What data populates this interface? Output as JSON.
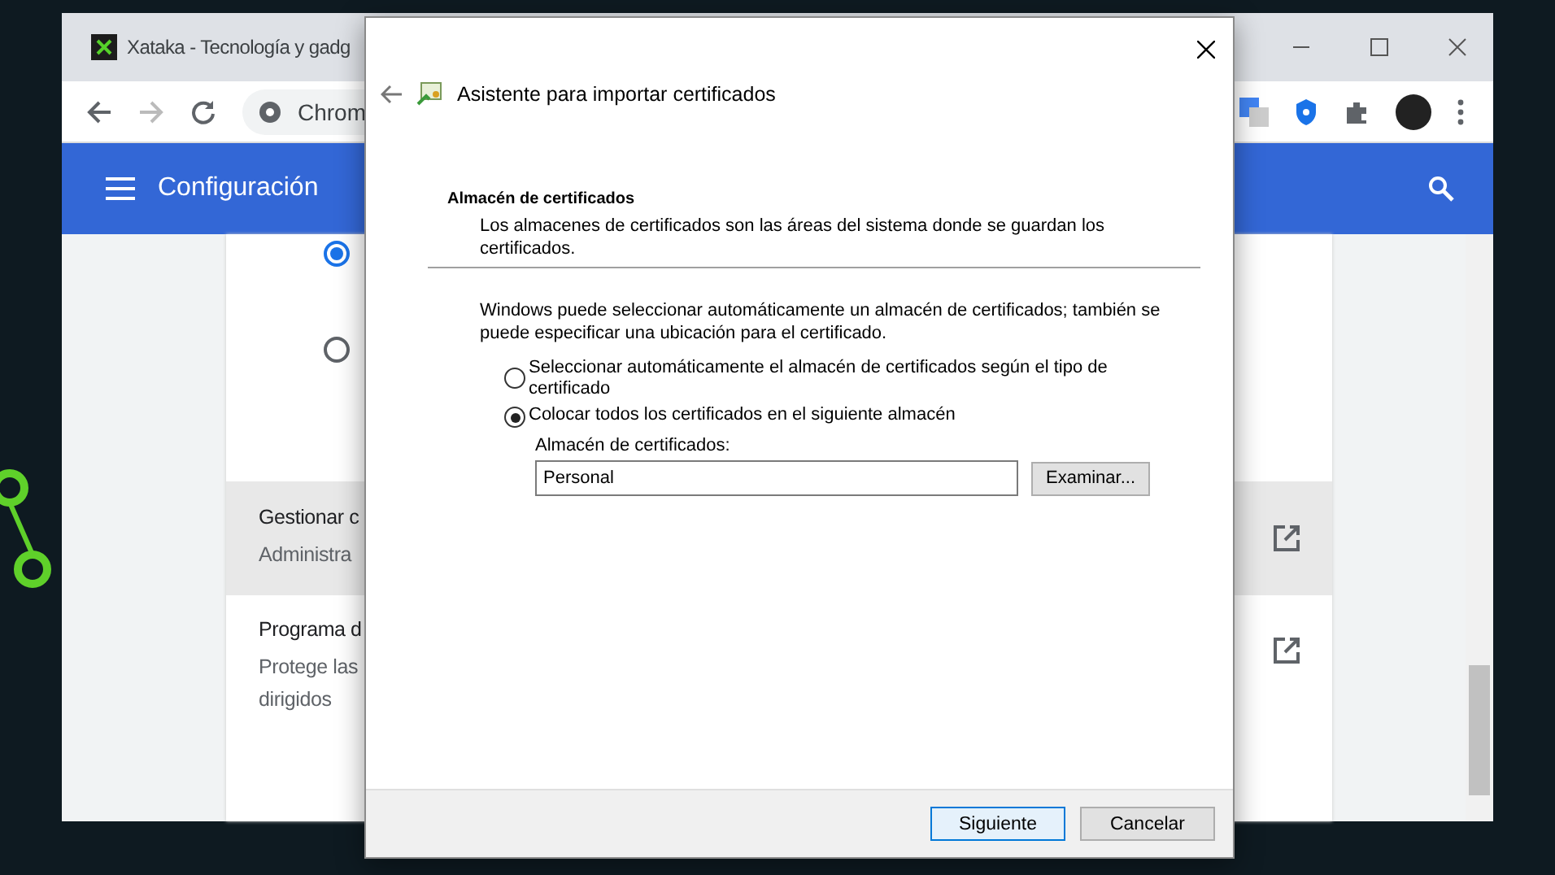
{
  "browser": {
    "tab_title": "Xataka - Tecnología y gadg",
    "address": "Chrom",
    "header_title": "Configuración",
    "radios": [
      {
        "selected": true
      },
      {
        "selected": false
      }
    ],
    "rows": [
      {
        "title": "Gestionar c",
        "lines": [
          "Administra"
        ],
        "highlighted": true
      },
      {
        "title": "Programa d",
        "lines": [
          "Protege las",
          "dirigidos"
        ],
        "highlighted": false
      }
    ]
  },
  "dialog": {
    "title": "Asistente para importar certificados",
    "section_title": "Almacén de certificados",
    "section_description": "Los almacenes de certificados son las áreas del sistema donde se guardan los certificados.",
    "intro": "Windows puede seleccionar automáticamente un almacén de certificados; también se puede especificar una ubicación para el certificado.",
    "options": [
      {
        "label": "Seleccionar automáticamente el almacén de certificados según el tipo de certificado",
        "selected": false
      },
      {
        "label": "Colocar todos los certificados en el siguiente almacén",
        "selected": true
      }
    ],
    "store_label": "Almacén de certificados:",
    "store_value": "Personal",
    "browse_button": "Examinar...",
    "buttons": [
      {
        "label": "Siguiente",
        "default": true
      },
      {
        "label": "Cancelar",
        "default": false
      }
    ]
  }
}
